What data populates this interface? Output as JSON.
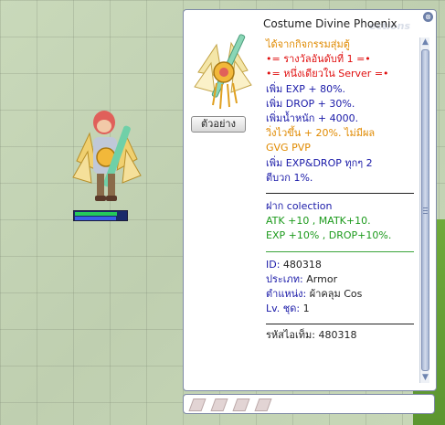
{
  "window": {
    "title": "Costume Divine Phoenix",
    "watermark": "ections",
    "close_symbol": "⊗",
    "preview_button_label": "ตัวอย่าง"
  },
  "description": {
    "line1": "ได้จากกิจกรรมสุ่มตู้",
    "line2": "•= รางวัลอันดับที่ 1 =•",
    "line3": "•= หนึ่งเดียวใน Server =•",
    "line4": "เพิ่ม EXP  + 80%.",
    "line5": "เพิ่ม DROP + 30%.",
    "line6": "เพิ่มน้ำหนัก + 4000.",
    "line7": "วิ่งไวขึ้น + 20%. ไม่มีผล",
    "line8": "GVG PVP",
    "line9": "เพิ่ม EXP&DROP ทุกๆ 2",
    "line10": "ตีบวก 1%.",
    "collection_header": "ฝาก colection",
    "collection1": " ATK +10 , MATK+10.",
    "collection2": " EXP +10% , DROP+10%.",
    "id_label": "ID:",
    "id_value": " 480318",
    "type_label": "ประเภท:",
    "type_value": " Armor",
    "position_label": "ตำแหน่ง:",
    "position_value": " ผ้าคลุม Cos",
    "level_label": "Lv. ชุด:",
    "level_value": " 1",
    "code_label": "รหัสไอเท็ม:",
    "code_value": " 480318"
  },
  "character": {
    "hp_fraction": 0.8,
    "sp_fraction": 0.78
  },
  "colors": {
    "orange": "#e08a00",
    "red": "#e01010",
    "blue": "#1a1aa8",
    "green": "#1c9a1c",
    "grass": "#6faa3a"
  },
  "icons": {
    "close": "close-icon",
    "scroll_up": "scroll-up-icon",
    "scroll_down": "scroll-down-icon",
    "card_slot": "card-slot-icon"
  }
}
